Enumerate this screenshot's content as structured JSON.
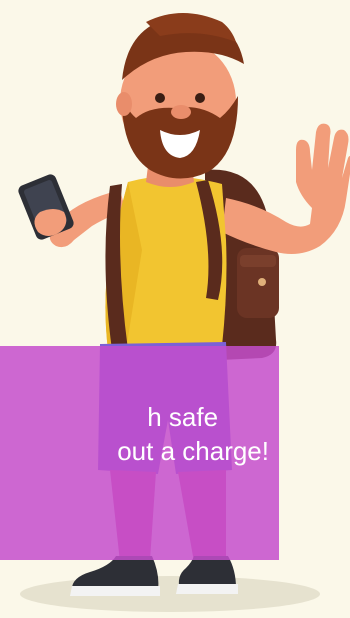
{
  "colors": {
    "background": "#fbf8e9",
    "banner": "#c44ecc",
    "banner_text": "#ffffff",
    "beard": "#7a3417",
    "hair": "#7a3417",
    "skin": "#f29d7a",
    "tank_top": "#f2c530",
    "backpack": "#5a2b1d",
    "shorts": "#7b61d6",
    "leggings": "#d44f9a",
    "shoes": "#2d2f36"
  },
  "illustration": {
    "icon": "traveler-waving-with-phone-illustration"
  },
  "banner": {
    "line1": "h safe",
    "line2": "out a charge!"
  }
}
